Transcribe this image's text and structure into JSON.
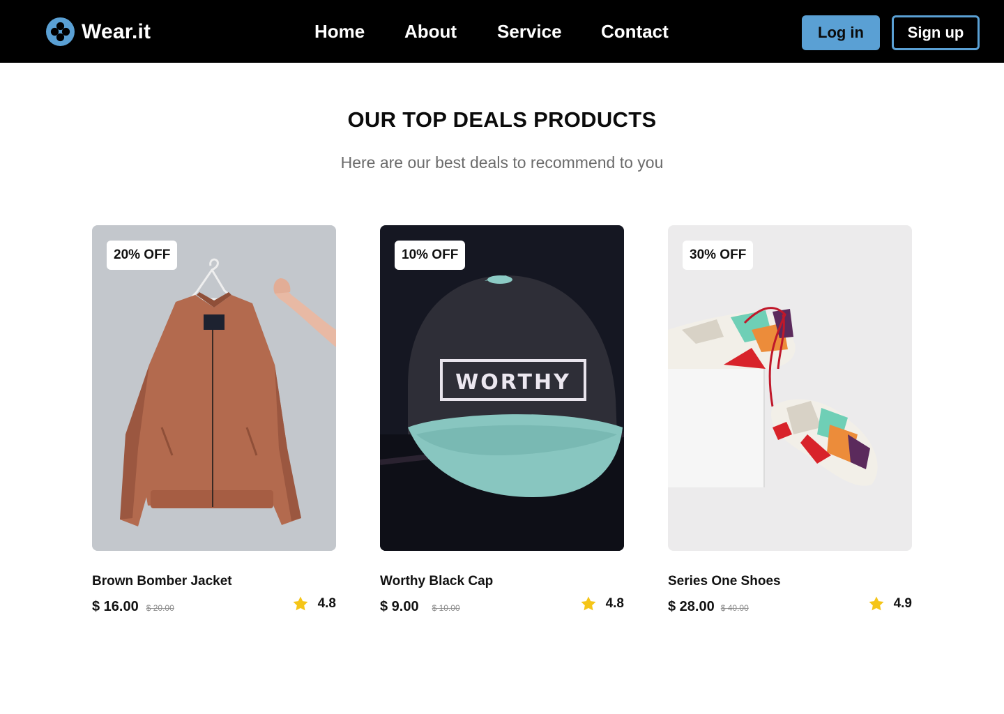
{
  "header": {
    "brand": "Wear.it",
    "logo_icon": "clover-logo-icon",
    "nav": [
      {
        "label": "Home"
      },
      {
        "label": "About"
      },
      {
        "label": "Service"
      },
      {
        "label": "Contact"
      }
    ],
    "login_label": "Log in",
    "signup_label": "Sign up",
    "accent_color": "#5aa0d4"
  },
  "section": {
    "title": "OUR TOP DEALS PRODUCTS",
    "subtitle": "Here are our best deals to recommend to you"
  },
  "products": [
    {
      "name": "Brown Bomber Jacket",
      "discount": "20% OFF",
      "price": "$ 16.00",
      "old_price": "$ 20.00",
      "rating": "4.8",
      "image": "brown-bomber-jacket-photo"
    },
    {
      "name": "Worthy Black Cap",
      "discount": "10% OFF",
      "price": "$ 9.00",
      "old_price": "$ 10.00",
      "rating": "4.8",
      "image": "worthy-black-cap-photo",
      "cap_text": "WORTHY"
    },
    {
      "name": "Series One Shoes",
      "discount": "30% OFF",
      "price": "$ 28.00",
      "old_price": "$ 40.00",
      "rating": "4.9",
      "image": "series-one-shoes-photo"
    }
  ],
  "star_color": "#f5c518"
}
